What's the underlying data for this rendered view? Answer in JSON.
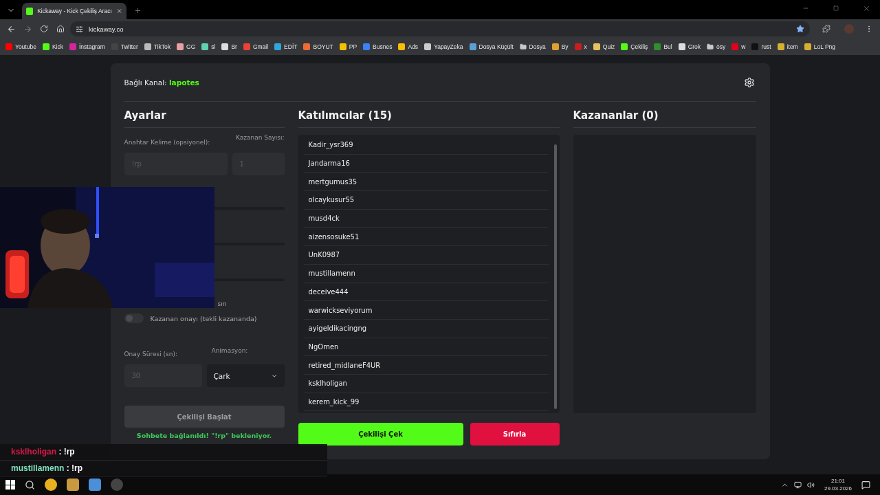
{
  "browser": {
    "tab_title": "Kickaway - Kick Çekiliş Aracı",
    "url": "kickaway.co",
    "bookmarks": [
      {
        "label": "Youtube",
        "kind": "site",
        "color": "#ff0000"
      },
      {
        "label": "Kick",
        "kind": "site",
        "color": "#53fc18"
      },
      {
        "label": "İnstagram",
        "kind": "site",
        "color": "#d6249f"
      },
      {
        "label": "Twitter",
        "kind": "site",
        "color": "#444444"
      },
      {
        "label": "TikTok",
        "kind": "site",
        "color": "#bbbbbb"
      },
      {
        "label": "GG",
        "kind": "site",
        "color": "#e8a0a0"
      },
      {
        "label": "sl",
        "kind": "site",
        "color": "#5fd3b0"
      },
      {
        "label": "Br",
        "kind": "site",
        "color": "#dddddd"
      },
      {
        "label": "Gmail",
        "kind": "site",
        "color": "#ea4335"
      },
      {
        "label": "EDİT",
        "kind": "site",
        "color": "#2fa8e0"
      },
      {
        "label": "BOYUT",
        "kind": "site",
        "color": "#f06a35"
      },
      {
        "label": "PP",
        "kind": "site",
        "color": "#f2c200"
      },
      {
        "label": "Busnes",
        "kind": "site",
        "color": "#3b82f6"
      },
      {
        "label": "Ads",
        "kind": "site",
        "color": "#fbbc04"
      },
      {
        "label": "YapayZeka",
        "kind": "site",
        "color": "#cccccc"
      },
      {
        "label": "Dosya Küçült",
        "kind": "site",
        "color": "#5aa0d8"
      },
      {
        "label": "Dosya",
        "kind": "folder",
        "color": "#c8c8c8"
      },
      {
        "label": "By",
        "kind": "site",
        "color": "#e0a030"
      },
      {
        "label": "x",
        "kind": "site",
        "color": "#c81e1e"
      },
      {
        "label": "Quiz",
        "kind": "site",
        "color": "#e8c060"
      },
      {
        "label": "Çekiliş",
        "kind": "site",
        "color": "#53fc18"
      },
      {
        "label": "Bul",
        "kind": "site",
        "color": "#2f8f2f"
      },
      {
        "label": "Grok",
        "kind": "site",
        "color": "#dddddd"
      },
      {
        "label": "ösy",
        "kind": "folder",
        "color": "#c8c8c8"
      },
      {
        "label": "w",
        "kind": "site",
        "color": "#e3001b"
      },
      {
        "label": "rust",
        "kind": "site",
        "color": "#111111"
      },
      {
        "label": "item",
        "kind": "site",
        "color": "#d8b030"
      },
      {
        "label": "LoL Png",
        "kind": "site",
        "color": "#d8b030"
      }
    ]
  },
  "header": {
    "label": "Bağlı Kanal:",
    "channel": "lapotes"
  },
  "settings": {
    "title": "Ayarlar",
    "keyword_label": "Anahtar Kelime (opsiyonel):",
    "keyword_placeholder": "!rp",
    "winners_label": "Kazanan Sayısı:",
    "winners_placeholder": "1",
    "partial_text": "sın",
    "toggle": {
      "label": "Kazanan onayı (tekli kazananda)",
      "on": false
    },
    "duration_label": "Onay Süresi (sn):",
    "duration_placeholder": "30",
    "animation_label": "Animasyon:",
    "animation_value": "Çark",
    "start_button": "Çekilişi Başlat",
    "status": "Sohbete bağlanıldı! \"!rp\" bekleniyor."
  },
  "participants": {
    "title": "Katılımcılar (15)",
    "items": [
      "Kadir_ysr369",
      "Jandarma16",
      "mertgumus35",
      "olcaykusur55",
      "musd4ck",
      "aizensosuke51",
      "UnK0987",
      "mustillamenn",
      "deceive444",
      "warwickseviyorum",
      "ayigeldikacingng",
      "NgOmen",
      "retired_midlaneF4UR",
      "ksklholigan",
      "kerem_kick_99"
    ]
  },
  "winners": {
    "title": "Kazananlar (0)"
  },
  "draw_button": "Çekilişi Çek",
  "reset_button": "Sıfırla",
  "chat": [
    {
      "user": "ksklholigan",
      "color": "#d8184a",
      "message": ": !rp"
    },
    {
      "user": "mustillamenn",
      "color": "#7fe3bd",
      "message": ": !rp"
    }
  ],
  "taskbar": {
    "time": "21:01",
    "date": "29.03.2026"
  }
}
